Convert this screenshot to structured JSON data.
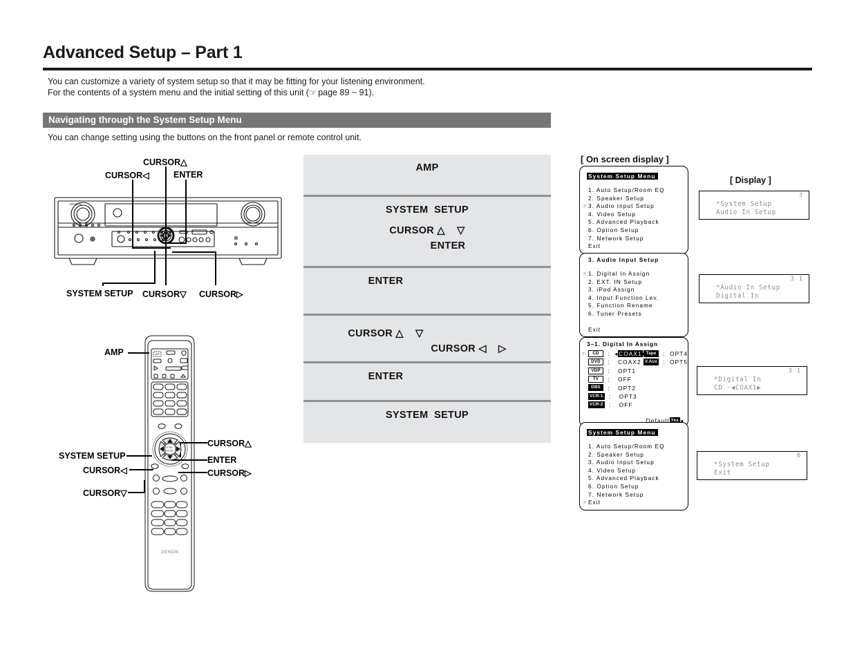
{
  "header": {
    "title": "Advanced Setup – Part 1",
    "intro_line1": "You can customize a variety of system setup so that it may be fitting for your listening environment.",
    "intro_line2_a": "For the contents of a system menu and the initial setting of this unit (",
    "intro_line2_icon": "pointing-hand-icon",
    "intro_line2_b": " page 89 ~ 91).",
    "section_bar": "Navigating through the System Setup Menu",
    "subnote": "You can change setting using the buttons on the front panel or remote control unit."
  },
  "front_panel": {
    "brand": "DENON",
    "labels": {
      "cursor_up": "CURSOR△",
      "cursor_left": "CURSOR◁",
      "enter": "ENTER",
      "system_setup": "SYSTEM SETUP",
      "cursor_down": "CURSOR▽",
      "cursor_right": "CURSOR▷"
    }
  },
  "remote": {
    "brand": "DENON",
    "labels": {
      "amp": "AMP",
      "system_setup": "SYSTEM SETUP",
      "cursor_left": "CURSOR◁",
      "cursor_down": "CURSOR▽",
      "cursor_up": "CURSOR△",
      "enter": "ENTER",
      "cursor_right": "CURSOR▷"
    }
  },
  "steps": [
    {
      "lines": [
        {
          "text": "AMP",
          "align": "center"
        }
      ]
    },
    {
      "lines": [
        {
          "text": "SYSTEM  SETUP",
          "align": "center"
        },
        {
          "text": "CURSOR △    ▽",
          "align": "center"
        },
        {
          "text": "ENTER",
          "align": "shiftR"
        }
      ]
    },
    {
      "lines": [
        {
          "text": "ENTER",
          "align": "shiftL"
        }
      ]
    },
    {
      "lines": [
        {
          "text": "CURSOR △    ▽",
          "align": "shiftL"
        },
        {
          "text": "CURSOR ◁    ▷",
          "align": "shiftR2"
        }
      ]
    },
    {
      "lines": [
        {
          "text": "ENTER",
          "align": "shiftL"
        }
      ]
    },
    {
      "lines": [
        {
          "text": "SYSTEM  SETUP",
          "align": "center"
        }
      ]
    }
  ],
  "osd": {
    "header": "[ On screen display ]",
    "display_header": "[ Display ]",
    "screens": [
      {
        "name": "system-setup-menu-top",
        "title": "System Setup Menu",
        "title_inverted": true,
        "rows": [
          {
            "text": "1. Auto Setup/Room EQ",
            "pointer": false
          },
          {
            "text": "2. Speaker Setup",
            "pointer": false
          },
          {
            "text": "3. Audio Input Setup",
            "pointer": true
          },
          {
            "text": "4. Video Setup",
            "pointer": false
          },
          {
            "text": "5. Advanced Playback",
            "pointer": false
          },
          {
            "text": "6. Option Setup",
            "pointer": false
          },
          {
            "text": "7. Network Setup",
            "pointer": false
          },
          {
            "text": "Exit",
            "pointer": false
          }
        ]
      },
      {
        "name": "audio-input-setup",
        "title": "3. Audio Input Setup",
        "title_inverted": false,
        "rows": [
          {
            "text": "1. Digital In Assign",
            "pointer": true
          },
          {
            "text": "2. EXT. IN Setup",
            "pointer": false
          },
          {
            "text": "3. iPod Assign",
            "pointer": false
          },
          {
            "text": "4. Input Function Lev.",
            "pointer": false
          },
          {
            "text": "5. Function Rename",
            "pointer": false
          },
          {
            "text": "6. Tuner Presets",
            "pointer": false
          },
          {
            "text": "",
            "pointer": false
          },
          {
            "text": "Exit",
            "pointer": false
          }
        ]
      },
      {
        "name": "system-setup-menu-bottom",
        "title": "System Setup Menu",
        "title_inverted": true,
        "rows": [
          {
            "text": "1. Auto Setup/Room EQ",
            "pointer": false
          },
          {
            "text": "2. Speaker Setup",
            "pointer": false
          },
          {
            "text": "3. Audio Input Setup",
            "pointer": false
          },
          {
            "text": "4. Video Setup",
            "pointer": false
          },
          {
            "text": "5. Advanced Playback",
            "pointer": false
          },
          {
            "text": "6. Option Setup",
            "pointer": false
          },
          {
            "text": "7. Network Setup",
            "pointer": false
          },
          {
            "text": "Exit",
            "pointer": true
          }
        ]
      }
    ],
    "digital_in_assign": {
      "title": "3–1. Digital  In Assign",
      "default_label": "Default",
      "default_value": "Yes",
      "left_column": [
        {
          "tag": "CD",
          "tag_inverted": false,
          "value": "COAX1",
          "value_selected": true,
          "arrows": true
        },
        {
          "tag": "DVD",
          "tag_inverted": false,
          "value": "COAX2",
          "value_selected": false,
          "arrows": false
        },
        {
          "tag": "VDP",
          "tag_inverted": false,
          "value": "OPT1",
          "value_selected": false,
          "arrows": false
        },
        {
          "tag": "TV",
          "tag_inverted": false,
          "value": "OFF",
          "value_selected": false,
          "arrows": false
        },
        {
          "tag": "DBS",
          "tag_inverted": true,
          "value": "OPT2",
          "value_selected": false,
          "arrows": false
        },
        {
          "tag": "VCR-1",
          "tag_inverted": true,
          "value": "OPT3",
          "value_selected": false,
          "arrows": false
        },
        {
          "tag": "VCR-2",
          "tag_inverted": true,
          "value": "OFF",
          "value_selected": false,
          "arrows": false
        }
      ],
      "right_column": [
        {
          "tag": "Tape",
          "tag_inverted": true,
          "value": "OPT4"
        },
        {
          "tag": "V.Aux",
          "tag_inverted": true,
          "value": "OPT5"
        }
      ]
    },
    "displays": [
      {
        "name": "display-system-setup-audio-in",
        "corner": "3",
        "line1": "*System Setup",
        "line2": "Audio In Setup"
      },
      {
        "name": "display-audio-in-digital-in",
        "corner": "3 1",
        "line1": "*Audio In Setup",
        "line2": "Digital In"
      },
      {
        "name": "display-digital-in-cd",
        "corner": "3 1",
        "line1": "*Digital In",
        "line2": "CD    ·◀COAX1▶"
      },
      {
        "name": "display-system-setup-exit",
        "corner": "0",
        "line1": "*System Setup",
        "line2": "Exit"
      }
    ]
  }
}
